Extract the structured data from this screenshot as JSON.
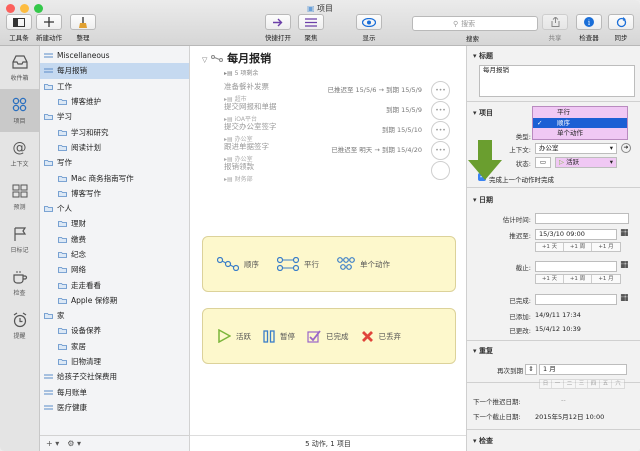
{
  "window": {
    "title": "项目"
  },
  "toolbar": {
    "sidebar_label": "工具条",
    "new_action_label": "新建动作",
    "clean_label": "整理",
    "quick_open_label": "快捷打开",
    "focus_label": "聚焦",
    "view_label": "显示",
    "search_placeholder": "搜索",
    "search_label": "搜索",
    "share_label": "共享",
    "inspector_label": "检查器",
    "sync_label": "同步"
  },
  "rail": {
    "items": [
      {
        "label": "收件箱"
      },
      {
        "label": "项目"
      },
      {
        "label": "上下文"
      },
      {
        "label": "预测"
      },
      {
        "label": "日标记"
      },
      {
        "label": "检查"
      },
      {
        "label": "提醒"
      }
    ]
  },
  "sidebar": {
    "items": [
      {
        "label": "Miscellaneous",
        "type": "list"
      },
      {
        "label": "每月报销",
        "type": "list",
        "selected": true
      },
      {
        "label": "工作",
        "type": "folder"
      },
      {
        "label": "博客维护",
        "type": "folder-child"
      },
      {
        "label": "学习",
        "type": "folder"
      },
      {
        "label": "学习和研究",
        "type": "folder-child"
      },
      {
        "label": "阅读计划",
        "type": "folder-child"
      },
      {
        "label": "写作",
        "type": "folder"
      },
      {
        "label": "Mac 商务指南写作",
        "type": "folder-child"
      },
      {
        "label": "博客写作",
        "type": "folder-child"
      },
      {
        "label": "个人",
        "type": "folder"
      },
      {
        "label": "理财",
        "type": "folder-child"
      },
      {
        "label": "缴费",
        "type": "folder-child"
      },
      {
        "label": "纪念",
        "type": "folder-child"
      },
      {
        "label": "网络",
        "type": "folder-child"
      },
      {
        "label": "走走看看",
        "type": "folder-child"
      },
      {
        "label": "Apple 保修期",
        "type": "folder-child"
      },
      {
        "label": "家",
        "type": "folder"
      },
      {
        "label": "设备保养",
        "type": "folder-child"
      },
      {
        "label": "家居",
        "type": "folder-child"
      },
      {
        "label": "旧物清理",
        "type": "folder-child"
      },
      {
        "label": "给孩子交社保费用",
        "type": "project"
      },
      {
        "label": "每月账单",
        "type": "project"
      },
      {
        "label": "医疗健康",
        "type": "project"
      }
    ],
    "add_label": "+ ▾",
    "gear_label": "⚙ ▾"
  },
  "main": {
    "project_title": "每月报销",
    "project_sub": "5 项剩余",
    "tasks": [
      {
        "name": "准备餐补发票",
        "context": "超市",
        "meta": "已推迟至 15/5/6 → 到期 15/5/9"
      },
      {
        "name": "提交网报和单据",
        "context": "iOA平台",
        "meta": "到期 15/5/9"
      },
      {
        "name": "提交办公室签字",
        "context": "办公室",
        "meta": "到期 15/5/10"
      },
      {
        "name": "跟进单据签字",
        "context": "办公室",
        "meta": "已推迟至 明天 → 到期 15/4/20"
      },
      {
        "name": "报销领款",
        "context": "财务部",
        "meta": ""
      }
    ],
    "type_box": {
      "sequential": "顺序",
      "parallel": "平行",
      "single": "单个动作"
    },
    "status_box": {
      "active": "活跃",
      "paused": "暂停",
      "done": "已完成",
      "dropped": "已丢弃"
    },
    "footer": "5 动作, 1 项目"
  },
  "inspector": {
    "title_section": "标题",
    "title_value": "每月报销",
    "project_section": "项目",
    "type_label": "类型:",
    "context_label": "上下文:",
    "context_value": "办公室",
    "status_label": "状态:",
    "status_value": "活跃",
    "type_menu": [
      {
        "label": "平行"
      },
      {
        "label": "顺序",
        "checked": true
      },
      {
        "label": "单个动作"
      }
    ],
    "complete_with_last": "完成上一个动作时完成",
    "dates_section": "日期",
    "estimate_label": "估计时间:",
    "defer_label": "推迟至:",
    "defer_value": "15/3/10 09:00",
    "due_label": "截止:",
    "completed_label": "已完成:",
    "added_label": "已添加:",
    "added_value": "14/9/11 17:34",
    "changed_label": "已更改:",
    "changed_value": "15/4/12 10:39",
    "steppers": [
      "+1 天",
      "+1 周",
      "+1 月"
    ],
    "repeat_section": "重复",
    "repeat_label": "再次到期",
    "repeat_value": "1 月",
    "weekdays": [
      "日",
      "一",
      "二",
      "三",
      "四",
      "五",
      "六"
    ],
    "next_defer_label": "下一个推迟日期:",
    "next_defer_value": "--",
    "next_due_label": "下一个截止日期:",
    "next_due_value": "2015年5月12日 10:00",
    "review_section": "检查"
  },
  "colors": {
    "accent": "#3a83f3",
    "selection": "#c5d9f0",
    "menu_highlight": "#f0c8f4",
    "arrow": "#6a9e2f",
    "box_bg": "#fdf8cc"
  }
}
